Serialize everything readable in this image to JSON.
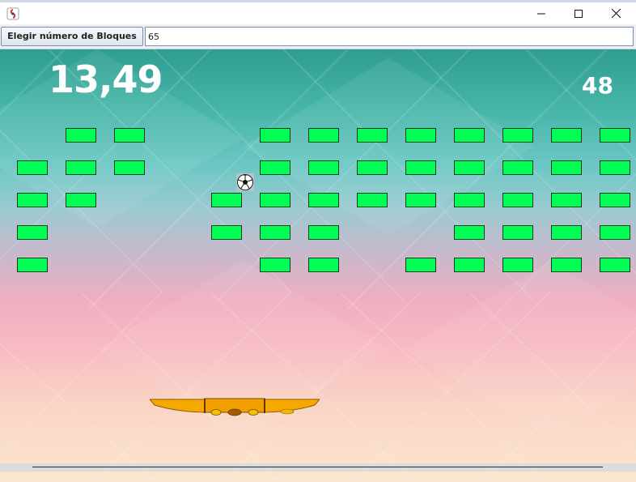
{
  "window": {
    "controls": [
      "minimize-icon",
      "maximize-icon",
      "close-icon"
    ]
  },
  "toolbar": {
    "button_label": "Elegir número de Bloques",
    "input_value": "65"
  },
  "game": {
    "timer": "13,49",
    "blocks_remaining": "48",
    "brick_color": "#00ff55",
    "paddle_color": "#f5a800",
    "ball_icon": "soccer-ball-icon",
    "brick_grid": {
      "columns": 13,
      "rows": 5,
      "present": [
        [
          0,
          1,
          1,
          0,
          0,
          1,
          1,
          1,
          1,
          1,
          1,
          1,
          1
        ],
        [
          1,
          1,
          1,
          0,
          0,
          1,
          1,
          1,
          1,
          1,
          1,
          1,
          1
        ],
        [
          1,
          1,
          0,
          0,
          1,
          1,
          1,
          1,
          1,
          1,
          1,
          1,
          1
        ],
        [
          1,
          0,
          0,
          0,
          1,
          1,
          1,
          0,
          0,
          1,
          1,
          1,
          1
        ],
        [
          1,
          0,
          0,
          0,
          0,
          1,
          1,
          0,
          1,
          1,
          1,
          1,
          1
        ]
      ]
    }
  }
}
